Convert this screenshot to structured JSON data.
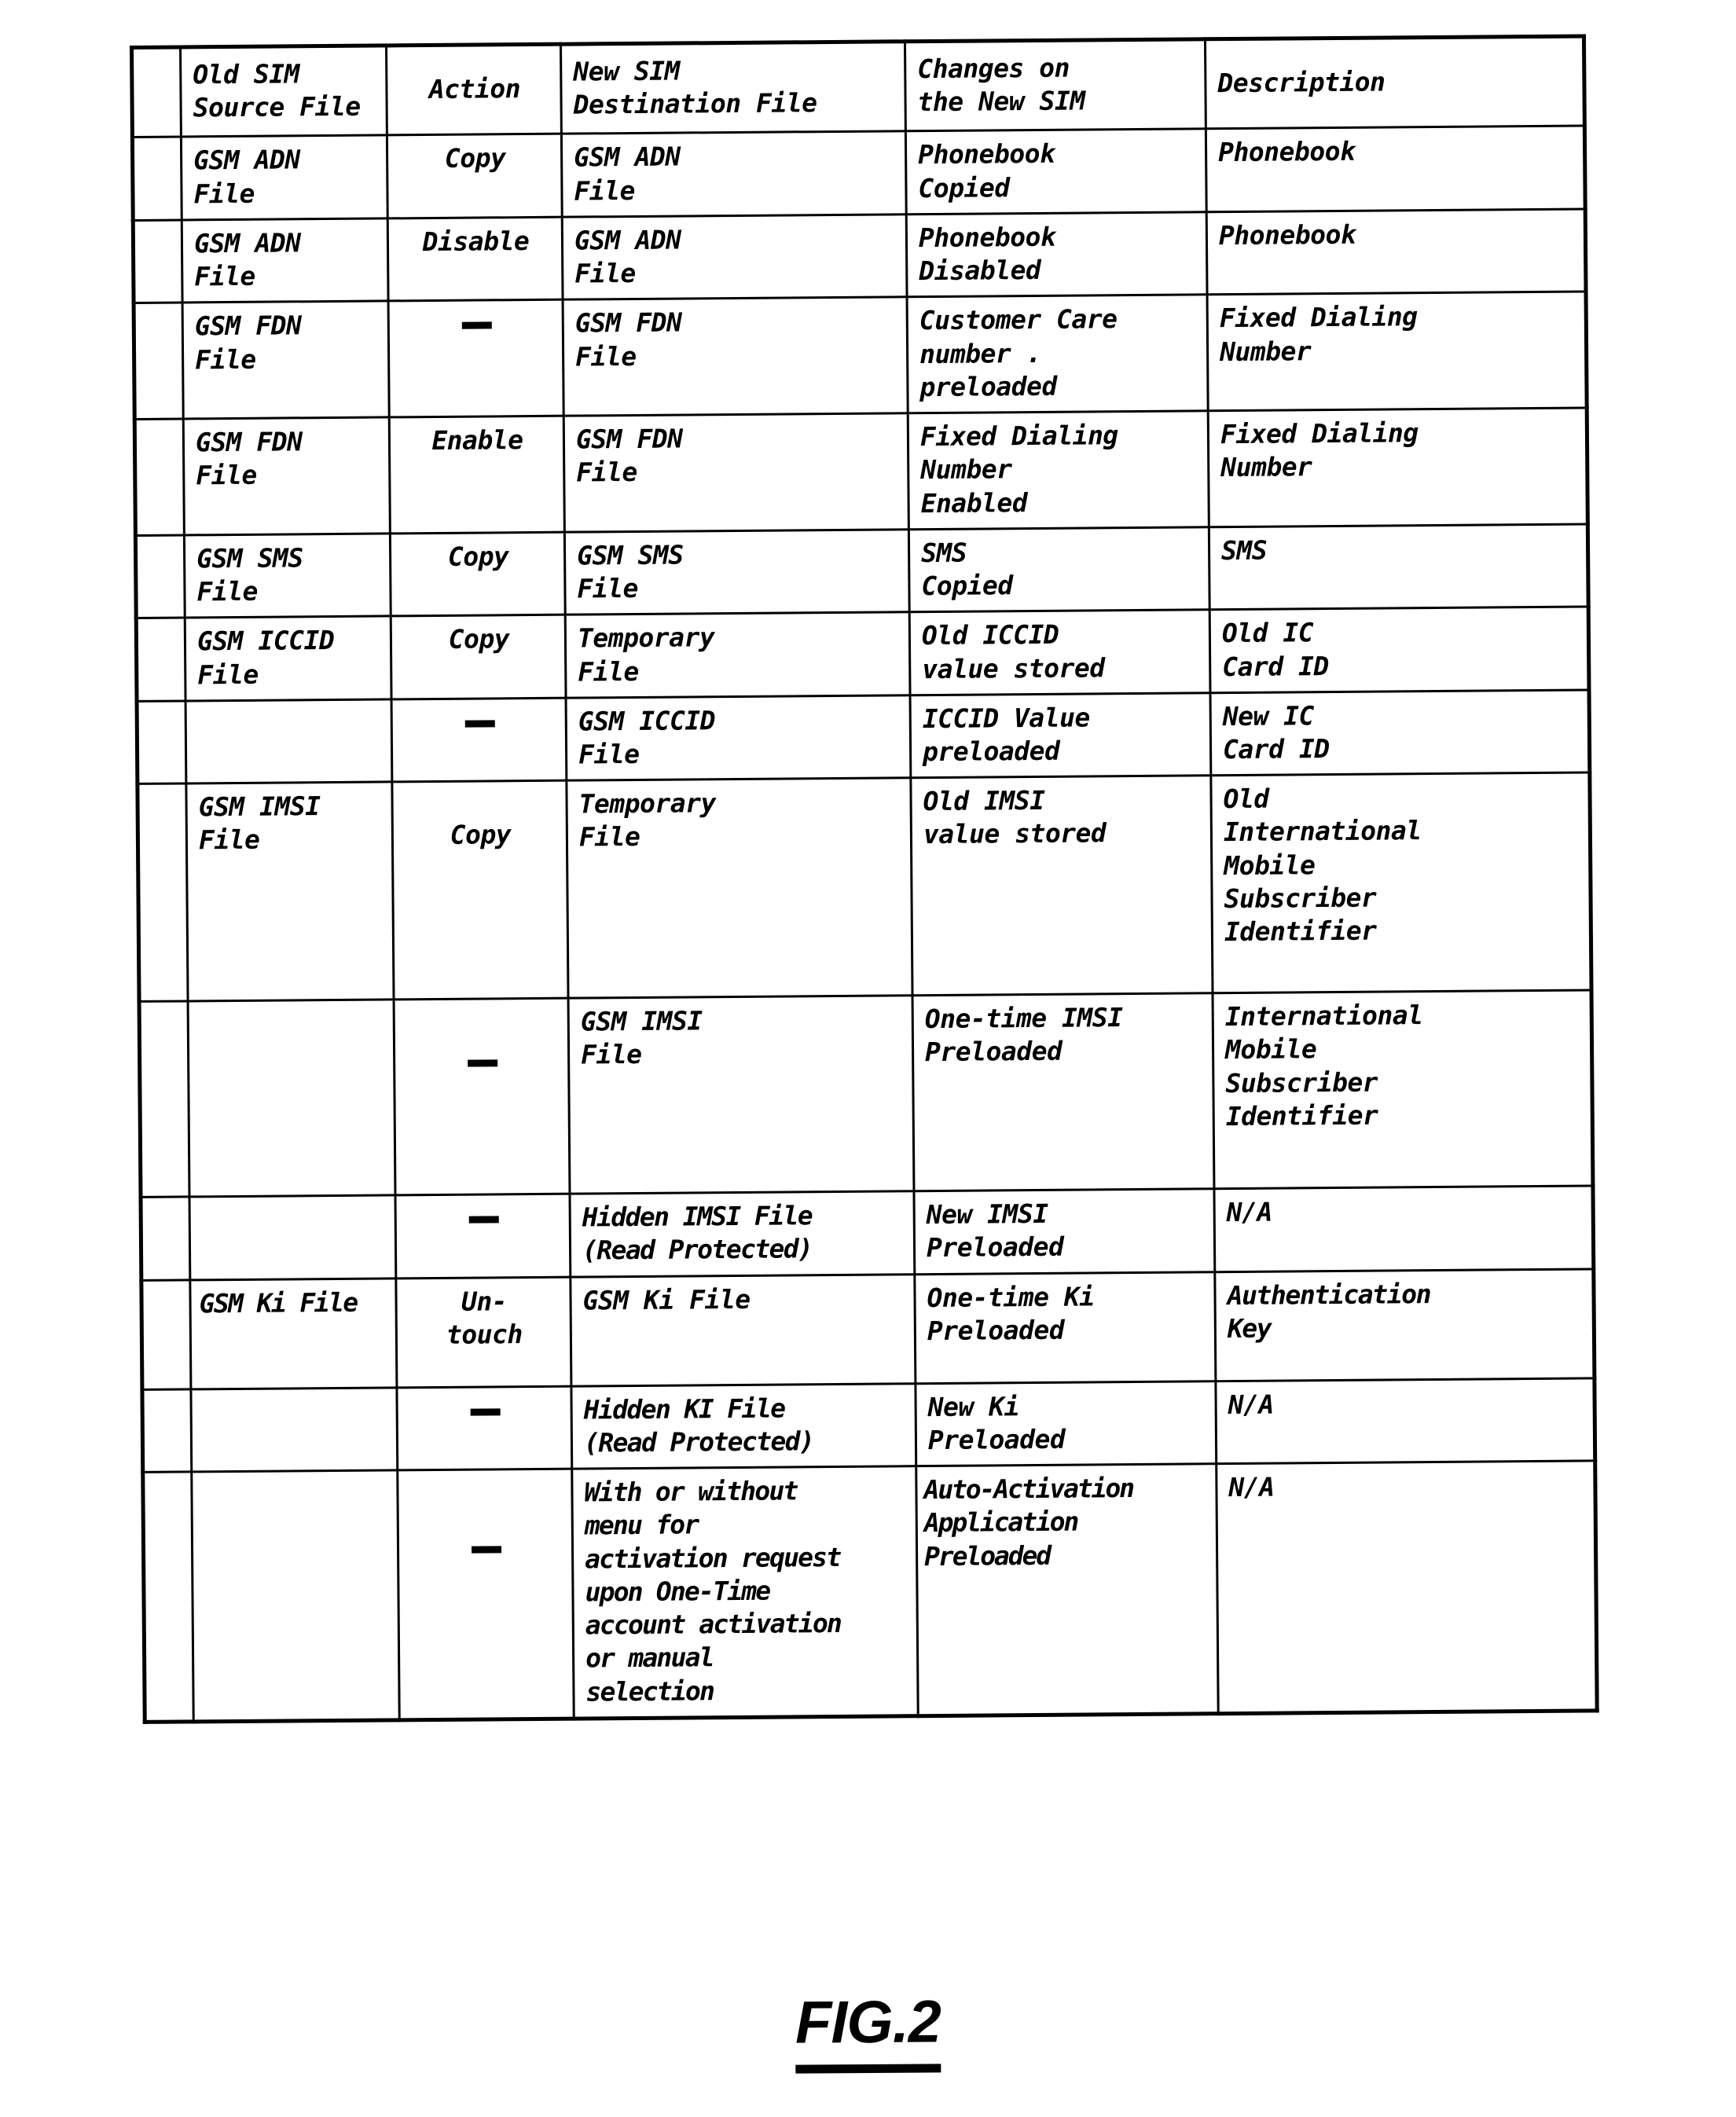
{
  "figure": {
    "caption": "FIG.2"
  },
  "table": {
    "columns": [
      {
        "key": "marker",
        "label": ""
      },
      {
        "key": "old_sim",
        "label": "Old SIM\nSource File"
      },
      {
        "key": "action",
        "label": "Action"
      },
      {
        "key": "new_sim",
        "label": "New SIM\nDestination File"
      },
      {
        "key": "changes",
        "label": "Changes on\nthe New SIM"
      },
      {
        "key": "desc",
        "label": "Description"
      }
    ],
    "dash_symbol": "—",
    "rows": [
      {
        "old_sim": "GSM ADN\nFile",
        "action": "Copy",
        "new_sim": "GSM ADN\nFile",
        "changes": "Phonebook\nCopied",
        "desc": "Phonebook"
      },
      {
        "old_sim": "GSM ADN\nFile",
        "action": "Disable",
        "new_sim": "GSM ADN\nFile",
        "changes": "Phonebook\nDisabled",
        "desc": "Phonebook"
      },
      {
        "old_sim": "GSM FDN\nFile",
        "action": "",
        "new_sim": "GSM FDN\nFile",
        "changes": "Customer Care\nnumber  .\npreloaded",
        "desc": "Fixed Dialing\nNumber"
      },
      {
        "old_sim": "GSM FDN\nFile",
        "action": "Enable",
        "new_sim": "GSM FDN\nFile",
        "changes": "Fixed Dialing\nNumber\nEnabled",
        "desc": "Fixed Dialing\nNumber"
      },
      {
        "old_sim": "GSM SMS\nFile",
        "action": "Copy",
        "new_sim": "GSM SMS\nFile",
        "changes": "SMS\nCopied",
        "desc": "SMS"
      },
      {
        "old_sim": "GSM ICCID\nFile",
        "action": "Copy",
        "new_sim": "Temporary\nFile",
        "changes": "Old ICCID\nvalue stored",
        "desc": "Old IC\nCard ID"
      },
      {
        "old_sim": "",
        "action": "",
        "new_sim": "GSM ICCID\nFile",
        "changes": "ICCID Value\npreloaded",
        "desc": "New IC\nCard ID"
      },
      {
        "old_sim": "GSM IMSI\nFile",
        "action": "Copy",
        "new_sim": "Temporary\nFile",
        "changes": "Old IMSI\nvalue stored",
        "desc": "Old\nInternational\nMobile\nSubscriber\nIdentifier"
      },
      {
        "old_sim": "",
        "action": "",
        "new_sim": "GSM IMSI\nFile",
        "changes": "One-time IMSI\nPreloaded",
        "desc": "International\nMobile\nSubscriber\nIdentifier"
      },
      {
        "old_sim": "",
        "action": "",
        "new_sim": "Hidden IMSI File\n(Read Protected)",
        "changes": "New IMSI\nPreloaded",
        "desc": "N/A"
      },
      {
        "old_sim": "GSM Ki File",
        "action": "Un-\ntouch",
        "new_sim": "GSM Ki File",
        "changes": "One-time Ki\nPreloaded",
        "desc": "Authentication\nKey"
      },
      {
        "old_sim": "",
        "action": "",
        "new_sim": "Hidden KI File\n(Read Protected)",
        "changes": "New Ki\nPreloaded",
        "desc": "N/A"
      },
      {
        "old_sim": "",
        "action": "",
        "new_sim": "With or without\nmenu for\nactivation request\nupon One-Time\naccount activation\nor manual\nselection",
        "changes": "Auto-Activation\nApplication\nPreloaded",
        "desc": "N/A"
      }
    ]
  }
}
